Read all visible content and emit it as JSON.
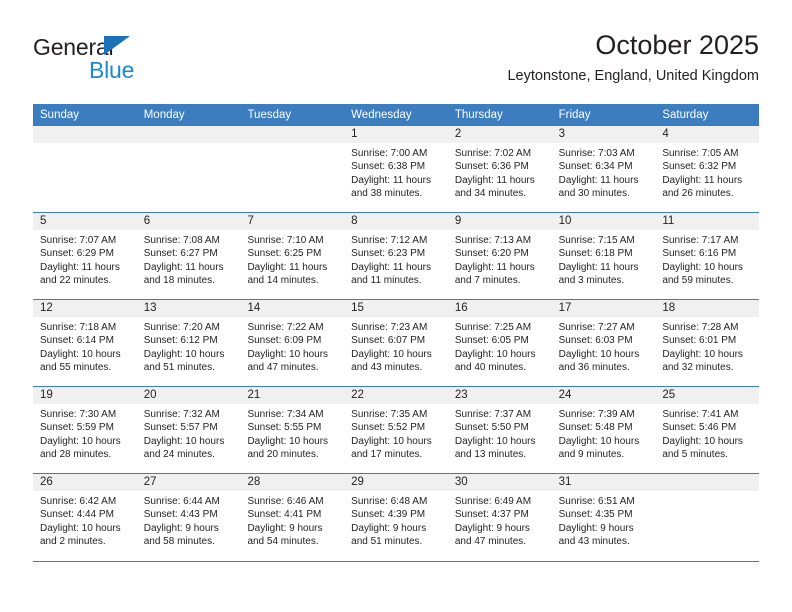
{
  "brand": {
    "name_top": "General",
    "name_bottom": "Blue",
    "accent_color": "#1b8ad4",
    "triangle_color": "#1b72b8"
  },
  "header": {
    "title": "October 2025",
    "subtitle": "Leytonstone, England, United Kingdom"
  },
  "calendar": {
    "header_color": "#3b7dbf",
    "day_band_color": "#f0f0f0",
    "weekdays": [
      "Sunday",
      "Monday",
      "Tuesday",
      "Wednesday",
      "Thursday",
      "Friday",
      "Saturday"
    ],
    "weeks": [
      [
        {
          "day": "",
          "lines": []
        },
        {
          "day": "",
          "lines": []
        },
        {
          "day": "",
          "lines": []
        },
        {
          "day": "1",
          "lines": [
            "Sunrise: 7:00 AM",
            "Sunset: 6:38 PM",
            "Daylight: 11 hours",
            "and 38 minutes."
          ]
        },
        {
          "day": "2",
          "lines": [
            "Sunrise: 7:02 AM",
            "Sunset: 6:36 PM",
            "Daylight: 11 hours",
            "and 34 minutes."
          ]
        },
        {
          "day": "3",
          "lines": [
            "Sunrise: 7:03 AM",
            "Sunset: 6:34 PM",
            "Daylight: 11 hours",
            "and 30 minutes."
          ]
        },
        {
          "day": "4",
          "lines": [
            "Sunrise: 7:05 AM",
            "Sunset: 6:32 PM",
            "Daylight: 11 hours",
            "and 26 minutes."
          ]
        }
      ],
      [
        {
          "day": "5",
          "lines": [
            "Sunrise: 7:07 AM",
            "Sunset: 6:29 PM",
            "Daylight: 11 hours",
            "and 22 minutes."
          ]
        },
        {
          "day": "6",
          "lines": [
            "Sunrise: 7:08 AM",
            "Sunset: 6:27 PM",
            "Daylight: 11 hours",
            "and 18 minutes."
          ]
        },
        {
          "day": "7",
          "lines": [
            "Sunrise: 7:10 AM",
            "Sunset: 6:25 PM",
            "Daylight: 11 hours",
            "and 14 minutes."
          ]
        },
        {
          "day": "8",
          "lines": [
            "Sunrise: 7:12 AM",
            "Sunset: 6:23 PM",
            "Daylight: 11 hours",
            "and 11 minutes."
          ]
        },
        {
          "day": "9",
          "lines": [
            "Sunrise: 7:13 AM",
            "Sunset: 6:20 PM",
            "Daylight: 11 hours",
            "and 7 minutes."
          ]
        },
        {
          "day": "10",
          "lines": [
            "Sunrise: 7:15 AM",
            "Sunset: 6:18 PM",
            "Daylight: 11 hours",
            "and 3 minutes."
          ]
        },
        {
          "day": "11",
          "lines": [
            "Sunrise: 7:17 AM",
            "Sunset: 6:16 PM",
            "Daylight: 10 hours",
            "and 59 minutes."
          ]
        }
      ],
      [
        {
          "day": "12",
          "lines": [
            "Sunrise: 7:18 AM",
            "Sunset: 6:14 PM",
            "Daylight: 10 hours",
            "and 55 minutes."
          ]
        },
        {
          "day": "13",
          "lines": [
            "Sunrise: 7:20 AM",
            "Sunset: 6:12 PM",
            "Daylight: 10 hours",
            "and 51 minutes."
          ]
        },
        {
          "day": "14",
          "lines": [
            "Sunrise: 7:22 AM",
            "Sunset: 6:09 PM",
            "Daylight: 10 hours",
            "and 47 minutes."
          ]
        },
        {
          "day": "15",
          "lines": [
            "Sunrise: 7:23 AM",
            "Sunset: 6:07 PM",
            "Daylight: 10 hours",
            "and 43 minutes."
          ]
        },
        {
          "day": "16",
          "lines": [
            "Sunrise: 7:25 AM",
            "Sunset: 6:05 PM",
            "Daylight: 10 hours",
            "and 40 minutes."
          ]
        },
        {
          "day": "17",
          "lines": [
            "Sunrise: 7:27 AM",
            "Sunset: 6:03 PM",
            "Daylight: 10 hours",
            "and 36 minutes."
          ]
        },
        {
          "day": "18",
          "lines": [
            "Sunrise: 7:28 AM",
            "Sunset: 6:01 PM",
            "Daylight: 10 hours",
            "and 32 minutes."
          ]
        }
      ],
      [
        {
          "day": "19",
          "lines": [
            "Sunrise: 7:30 AM",
            "Sunset: 5:59 PM",
            "Daylight: 10 hours",
            "and 28 minutes."
          ]
        },
        {
          "day": "20",
          "lines": [
            "Sunrise: 7:32 AM",
            "Sunset: 5:57 PM",
            "Daylight: 10 hours",
            "and 24 minutes."
          ]
        },
        {
          "day": "21",
          "lines": [
            "Sunrise: 7:34 AM",
            "Sunset: 5:55 PM",
            "Daylight: 10 hours",
            "and 20 minutes."
          ]
        },
        {
          "day": "22",
          "lines": [
            "Sunrise: 7:35 AM",
            "Sunset: 5:52 PM",
            "Daylight: 10 hours",
            "and 17 minutes."
          ]
        },
        {
          "day": "23",
          "lines": [
            "Sunrise: 7:37 AM",
            "Sunset: 5:50 PM",
            "Daylight: 10 hours",
            "and 13 minutes."
          ]
        },
        {
          "day": "24",
          "lines": [
            "Sunrise: 7:39 AM",
            "Sunset: 5:48 PM",
            "Daylight: 10 hours",
            "and 9 minutes."
          ]
        },
        {
          "day": "25",
          "lines": [
            "Sunrise: 7:41 AM",
            "Sunset: 5:46 PM",
            "Daylight: 10 hours",
            "and 5 minutes."
          ]
        }
      ],
      [
        {
          "day": "26",
          "lines": [
            "Sunrise: 6:42 AM",
            "Sunset: 4:44 PM",
            "Daylight: 10 hours",
            "and 2 minutes."
          ]
        },
        {
          "day": "27",
          "lines": [
            "Sunrise: 6:44 AM",
            "Sunset: 4:43 PM",
            "Daylight: 9 hours",
            "and 58 minutes."
          ]
        },
        {
          "day": "28",
          "lines": [
            "Sunrise: 6:46 AM",
            "Sunset: 4:41 PM",
            "Daylight: 9 hours",
            "and 54 minutes."
          ]
        },
        {
          "day": "29",
          "lines": [
            "Sunrise: 6:48 AM",
            "Sunset: 4:39 PM",
            "Daylight: 9 hours",
            "and 51 minutes."
          ]
        },
        {
          "day": "30",
          "lines": [
            "Sunrise: 6:49 AM",
            "Sunset: 4:37 PM",
            "Daylight: 9 hours",
            "and 47 minutes."
          ]
        },
        {
          "day": "31",
          "lines": [
            "Sunrise: 6:51 AM",
            "Sunset: 4:35 PM",
            "Daylight: 9 hours",
            "and 43 minutes."
          ]
        },
        {
          "day": "",
          "lines": []
        }
      ]
    ]
  }
}
